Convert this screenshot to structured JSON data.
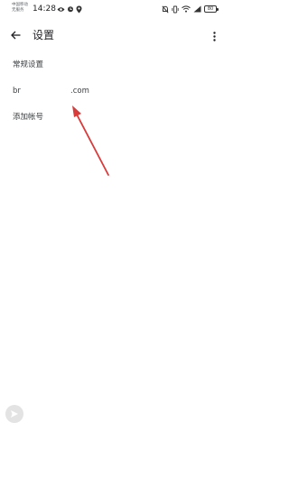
{
  "status_bar": {
    "carrier_line1": "中国移动",
    "carrier_line2": "无服务",
    "time": "14:28",
    "battery": "80",
    "icons": [
      "eye-icon",
      "alarm-icon",
      "location-icon",
      "mute-icon",
      "vibrate-icon",
      "wifi-icon",
      "signal-icon",
      "battery-icon"
    ]
  },
  "app_bar": {
    "title": "设置",
    "back_icon": "arrow-left-icon",
    "menu_icon": "more-vert-icon"
  },
  "settings": {
    "general_label": "常规设置",
    "account_prefix": "br",
    "account_suffix": ".com",
    "add_account_label": "添加帐号"
  },
  "colors": {
    "annotation_arrow": "#d93a3a",
    "text_primary": "#202124",
    "text_secondary": "#3c4043",
    "floating_button_bg": "#e3e3e3"
  }
}
